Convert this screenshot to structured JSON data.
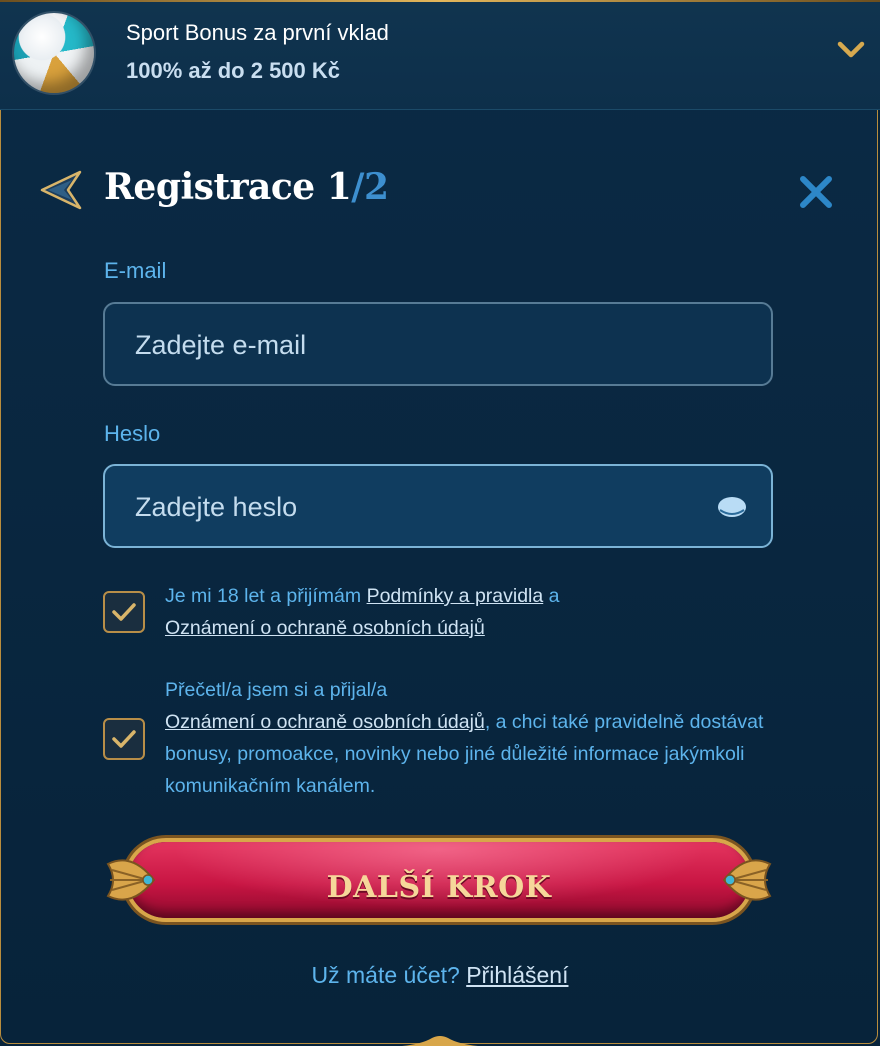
{
  "bonus": {
    "title": "Sport Bonus za první vklad",
    "amount": "100% až do 2 500 Kč",
    "icon": "volleyball-icon"
  },
  "header": {
    "title": "Registrace",
    "step_current": "1",
    "step_total": "/2"
  },
  "form": {
    "email_label": "E-mail",
    "email_placeholder": "Zadejte e-mail",
    "email_value": "",
    "password_label": "Heslo",
    "password_placeholder": "Zadejte heslo",
    "password_value": ""
  },
  "consents": {
    "terms_prefix": "Je mi 18 let a přijímám ",
    "terms_link": "Podmínky a pravidla",
    "terms_and": " a",
    "terms_privacy_link": "Oznámení o ochraně osobních údajů",
    "terms_checked": true,
    "marketing_prefix": "Přečetl/a jsem si a přijal/a",
    "marketing_privacy_link": "Oznámení o ochraně osobních údajů",
    "marketing_suffix": ", a chci také pravidelně dostávat bonusy, promoakce, novinky nebo jiné důležité informace jakýmkoli komunikačním kanálem.",
    "marketing_checked": true
  },
  "next_button": "DALŠÍ KROK",
  "footer": {
    "question": "Už máte účet? ",
    "login_link": "Přihlášení"
  },
  "colors": {
    "accent_blue": "#5db4ec",
    "gold": "#d8a64a",
    "button_red": "#c81543",
    "background": "#07233a"
  }
}
